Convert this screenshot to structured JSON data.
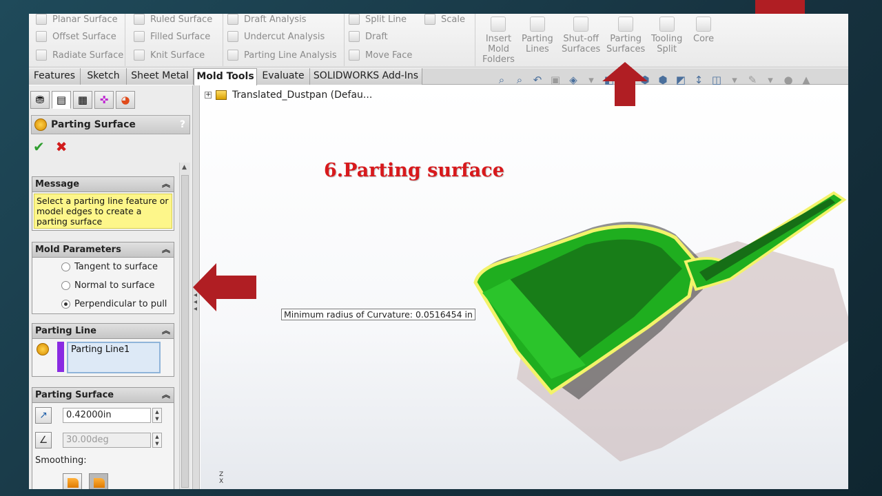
{
  "ribbon": {
    "surface_tools": [
      "Planar Surface",
      "Offset Surface",
      "Radiate Surface"
    ],
    "surface_tools_2": [
      "Ruled Surface",
      "Filled Surface",
      "Knit Surface"
    ],
    "analysis_tools": [
      "Draft Analysis",
      "Undercut Analysis",
      "Parting Line Analysis"
    ],
    "split_tools": [
      "Split Line",
      "Draft",
      "Move Face"
    ],
    "scale_label": "Scale",
    "mold_buttons": [
      {
        "label": "Insert\nMold\nFolders",
        "icon": "mold-folder-icon"
      },
      {
        "label": "Parting\nLines",
        "icon": "parting-lines-icon"
      },
      {
        "label": "Shut-off\nSurfaces",
        "icon": "shutoff-surfaces-icon"
      },
      {
        "label": "Parting\nSurfaces",
        "icon": "parting-surfaces-icon"
      },
      {
        "label": "Tooling\nSplit",
        "icon": "tooling-split-icon"
      },
      {
        "label": "Core",
        "icon": "core-icon"
      }
    ]
  },
  "tabs": [
    "Features",
    "Sketch",
    "Sheet Metal",
    "Mold Tools",
    "Evaluate",
    "SOLIDWORKS Add-Ins"
  ],
  "active_tab": "Mold Tools",
  "property_manager": {
    "title": "Parting Surface",
    "help": "?",
    "ok": "✔",
    "cancel": "✖",
    "message_header": "Message",
    "message_text": "Select a parting line feature or model edges to create a parting surface",
    "mold_params_header": "Mold Parameters",
    "options": [
      "Tangent to surface",
      "Normal to surface",
      "Perpendicular to pull"
    ],
    "selected_option": "Perpendicular to pull",
    "parting_line_header": "Parting Line",
    "parting_line_item": "Parting Line1",
    "parting_surface_header": "Parting Surface",
    "distance_value": "0.42000in",
    "angle_value": "30.00deg",
    "smoothing_label": "Smoothing:"
  },
  "tree": {
    "root": "Translated_Dustpan  (Defau..."
  },
  "viewport": {
    "slide_title": "6.Parting surface",
    "curvature_label": "Minimum radius of Curvature: 0.0516454 in",
    "triad_z": "Z",
    "triad_x": "X"
  },
  "colors": {
    "accent": "#b01e23",
    "title_red": "#d8191c",
    "model_green": "#1fae1f",
    "message_bg": "#fdf68a",
    "parting_line_color": "#8a2be2"
  }
}
